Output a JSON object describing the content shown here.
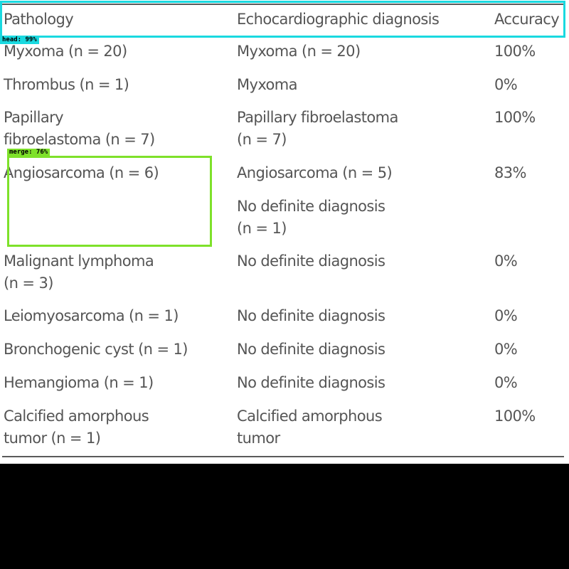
{
  "table": {
    "headers": [
      "Pathology",
      "Echocardiographic diagnosis",
      "Accuracy"
    ],
    "rows": [
      {
        "pathology": "Myxoma (n = 20)",
        "diagnosis": "Myxoma (n = 20)",
        "accuracy": "100%"
      },
      {
        "pathology": "Thrombus (n = 1)",
        "diagnosis": "Myxoma",
        "accuracy": "0%"
      },
      {
        "pathology": "Papillary\nfibroelastoma (n = 7)",
        "diagnosis": "Papillary fibroelastoma\n(n = 7)",
        "accuracy": "100%"
      },
      {
        "pathology": "Angiosarcoma (n = 6)",
        "diagnosis": "Angiosarcoma (n = 5)",
        "accuracy": "83%"
      },
      {
        "pathology": "",
        "diagnosis": "No definite diagnosis\n(n = 1)",
        "accuracy": ""
      },
      {
        "pathology": "Malignant lymphoma\n(n = 3)",
        "diagnosis": "No definite diagnosis",
        "accuracy": "0%"
      },
      {
        "pathology": "Leiomyosarcoma (n = 1)",
        "diagnosis": "No definite diagnosis",
        "accuracy": "0%"
      },
      {
        "pathology": "Bronchogenic cyst (n = 1)",
        "diagnosis": "No definite diagnosis",
        "accuracy": "0%"
      },
      {
        "pathology": "Hemangioma (n = 1)",
        "diagnosis": "No definite diagnosis",
        "accuracy": "0%"
      },
      {
        "pathology": "Calcified amorphous\ntumor (n = 1)",
        "diagnosis": "Calcified amorphous\ntumor",
        "accuracy": "100%"
      }
    ]
  },
  "annotations": {
    "head_label": "head: 99%",
    "merge_label": "merge: 76%",
    "head_color": "#19d9e0",
    "merge_color": "#7ee12a"
  },
  "colors": {
    "text": "#555555",
    "rule": "#5a5a5a",
    "background": "#ffffff",
    "padding_below": "#000000"
  }
}
